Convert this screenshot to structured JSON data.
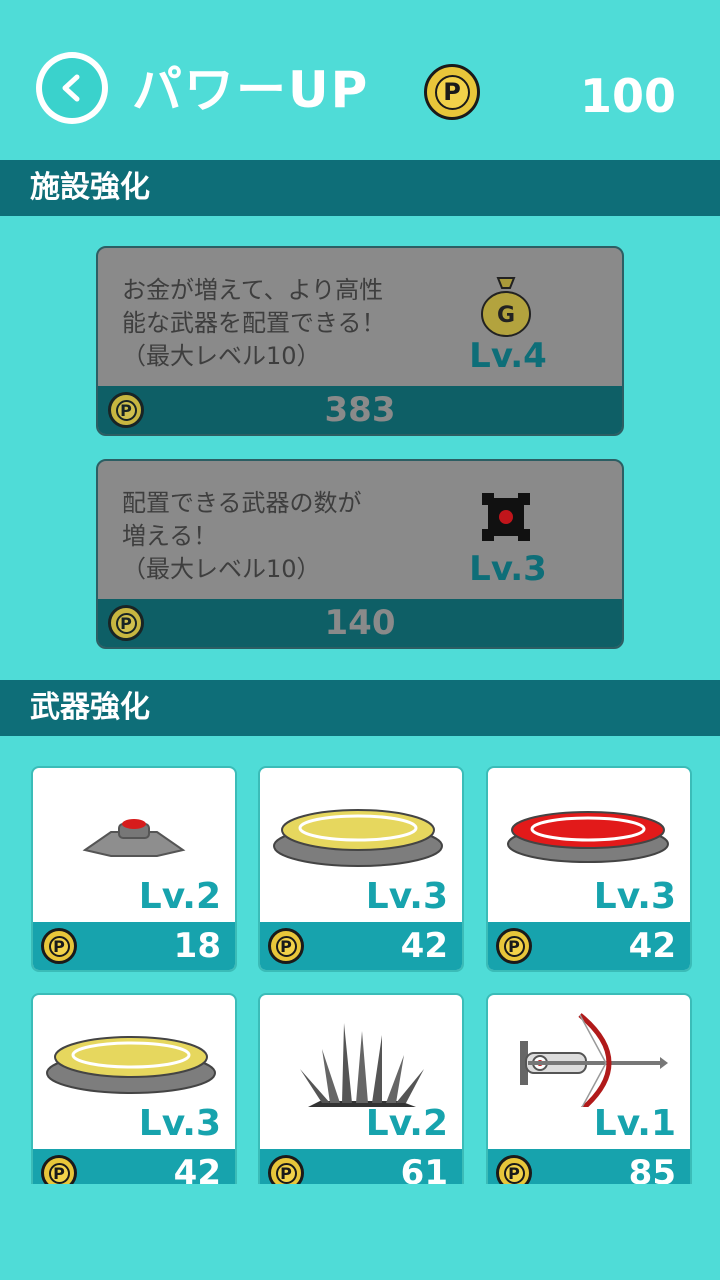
{
  "header": {
    "back_label": "<",
    "title": "パワーUP",
    "coin_symbol": "P",
    "points": "100"
  },
  "sections": {
    "facility_title": "施設強化",
    "weapon_title": "武器強化"
  },
  "facilities": [
    {
      "description": "お金が増えて、より高性\n能な武器を配置できる！\n（最大レベル10）",
      "icon": "money-bag-icon",
      "icon_text": "G",
      "level": "Lv.4",
      "cost": "383"
    },
    {
      "description": "配置できる武器の数が\n増える！\n（最大レベル10）",
      "icon": "placement-slot-icon",
      "level": "Lv.3",
      "cost": "140"
    }
  ],
  "weapons": [
    {
      "icon": "landmine-icon",
      "level": "Lv.2",
      "cost": "18"
    },
    {
      "icon": "yellow-trap-plate-icon",
      "level": "Lv.3",
      "cost": "42"
    },
    {
      "icon": "red-trap-plate-icon",
      "level": "Lv.3",
      "cost": "42"
    },
    {
      "icon": "yellow-trap-plate-icon",
      "level": "Lv.3",
      "cost": "42"
    },
    {
      "icon": "spike-trap-icon",
      "level": "Lv.2",
      "cost": "61"
    },
    {
      "icon": "crossbow-icon",
      "level": "Lv.1",
      "cost": "85"
    }
  ],
  "colors": {
    "background": "#4fdcd7",
    "section_bar": "#0e6e78",
    "accent": "#17a3ad",
    "coin": "#e8c63a"
  }
}
